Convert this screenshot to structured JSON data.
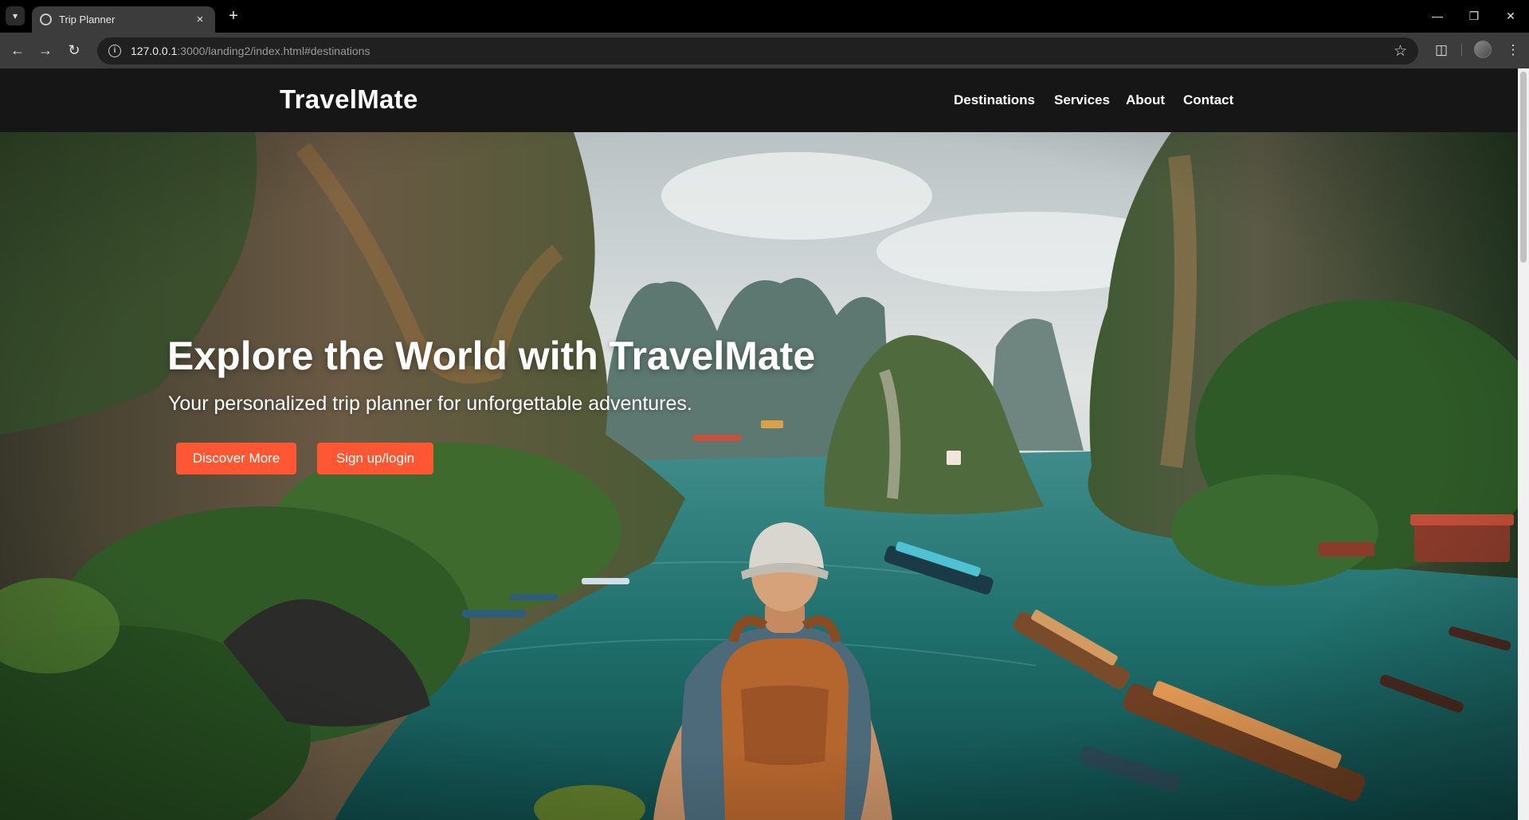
{
  "browser": {
    "tab_title": "Trip Planner",
    "tab_close": "×",
    "new_tab": "+",
    "url_host": "127.0.0.1",
    "url_path": ":3000/landing2/index.html#destinations",
    "icons": {
      "tab_menu": "chevron-down-icon",
      "back": "back-arrow-icon",
      "forward": "forward-arrow-icon",
      "reload": "reload-icon",
      "info": "info-icon",
      "star": "star-icon",
      "extensions": "puzzle-icon",
      "profile": "avatar",
      "menu": "kebab-menu-icon",
      "minimize": "minimize-icon",
      "restore": "restore-icon",
      "close": "close-icon"
    }
  },
  "site": {
    "logo": "TravelMate",
    "nav": [
      {
        "label": "Destinations"
      },
      {
        "label": "Services"
      },
      {
        "label": "About"
      },
      {
        "label": "Contact"
      }
    ],
    "hero": {
      "title": "Explore the World with TravelMate",
      "subtitle": "Your personalized trip planner for unforgettable adventures.",
      "primary_cta": "Discover More",
      "secondary_cta": "Sign up/login"
    },
    "colors": {
      "header_bg": "#161616",
      "accent": "#ff5733",
      "water": "#1f6f6c"
    }
  }
}
